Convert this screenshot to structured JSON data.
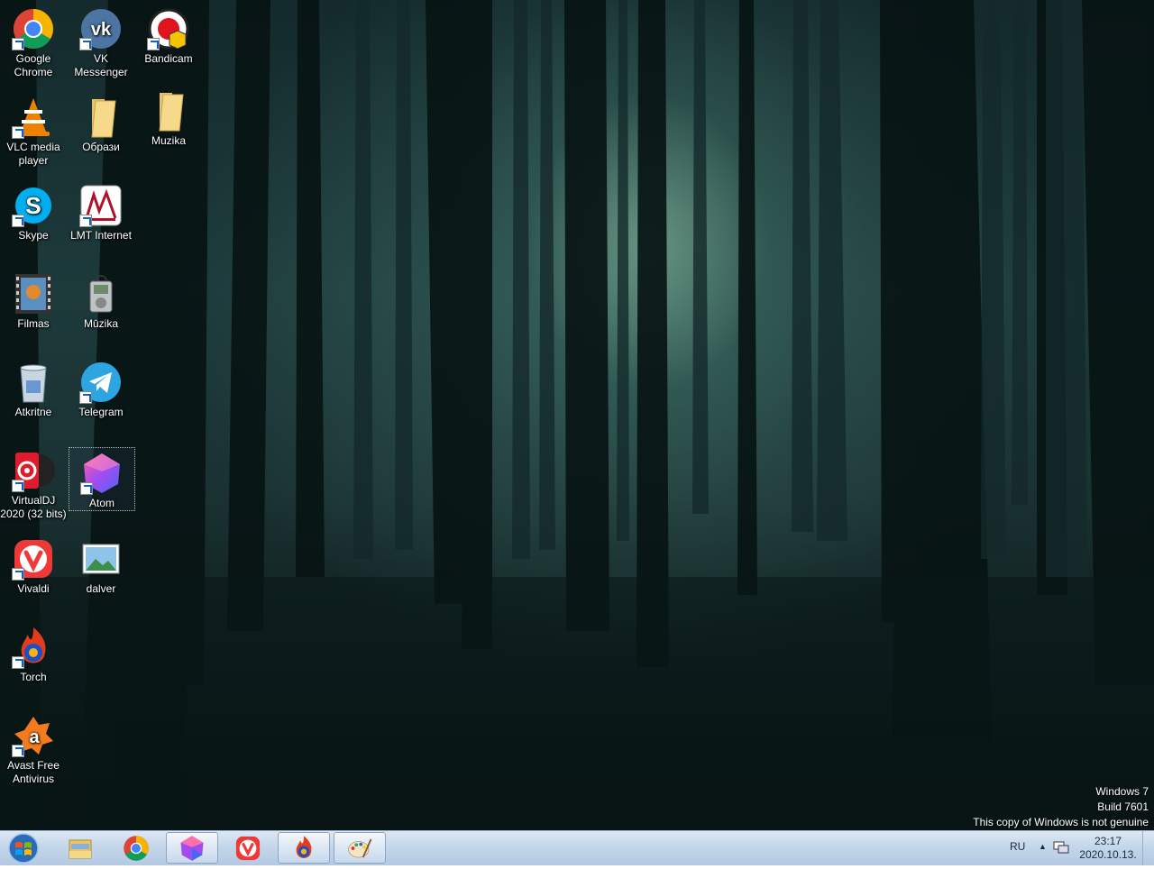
{
  "desktop": {
    "icons": [
      {
        "label": "Google\nChrome",
        "icon": "chrome-icon"
      },
      {
        "label": "VK\nMessenger",
        "icon": "vk-icon"
      },
      {
        "label": "Bandicam",
        "icon": "bandicam-icon"
      },
      {
        "label": "VLC media\nplayer",
        "icon": "vlc-icon"
      },
      {
        "label": "Образи",
        "icon": "folder-icon"
      },
      {
        "label": "Muzika",
        "icon": "folder-icon"
      },
      {
        "label": "Skype",
        "icon": "skype-icon"
      },
      {
        "label": "LMT Internet",
        "icon": "lmt-icon"
      },
      {
        "label": "Filmas",
        "icon": "film-icon"
      },
      {
        "label": "Mūzika",
        "icon": "music-player-icon"
      },
      {
        "label": "Atkritne",
        "icon": "recycle-bin-icon"
      },
      {
        "label": "Telegram",
        "icon": "telegram-icon"
      },
      {
        "label": "VirtualDJ\n2020 (32 bits)",
        "icon": "virtualdj-icon"
      },
      {
        "label": "Atom",
        "icon": "atom-icon"
      },
      {
        "label": "Vivaldi",
        "icon": "vivaldi-icon"
      },
      {
        "label": "dalver",
        "icon": "image-file-icon"
      },
      {
        "label": "Torch",
        "icon": "torch-icon"
      },
      {
        "label": "Avast Free\nAntivirus",
        "icon": "avast-icon"
      }
    ]
  },
  "watermark": {
    "line1": "Windows 7",
    "line2": "Build 7601",
    "line3": "This copy of Windows is not genuine"
  },
  "taskbar": {
    "pinned": [
      {
        "icon": "file-explorer-icon",
        "open": false
      },
      {
        "icon": "chrome-icon",
        "open": false
      },
      {
        "icon": "atom-icon",
        "open": true
      },
      {
        "icon": "vivaldi-icon",
        "open": false
      },
      {
        "icon": "torch-icon",
        "open": true
      },
      {
        "icon": "paint-icon",
        "open": true
      }
    ],
    "tray": {
      "language": "RU",
      "time": "23:17",
      "date": "2020.10.13."
    }
  }
}
